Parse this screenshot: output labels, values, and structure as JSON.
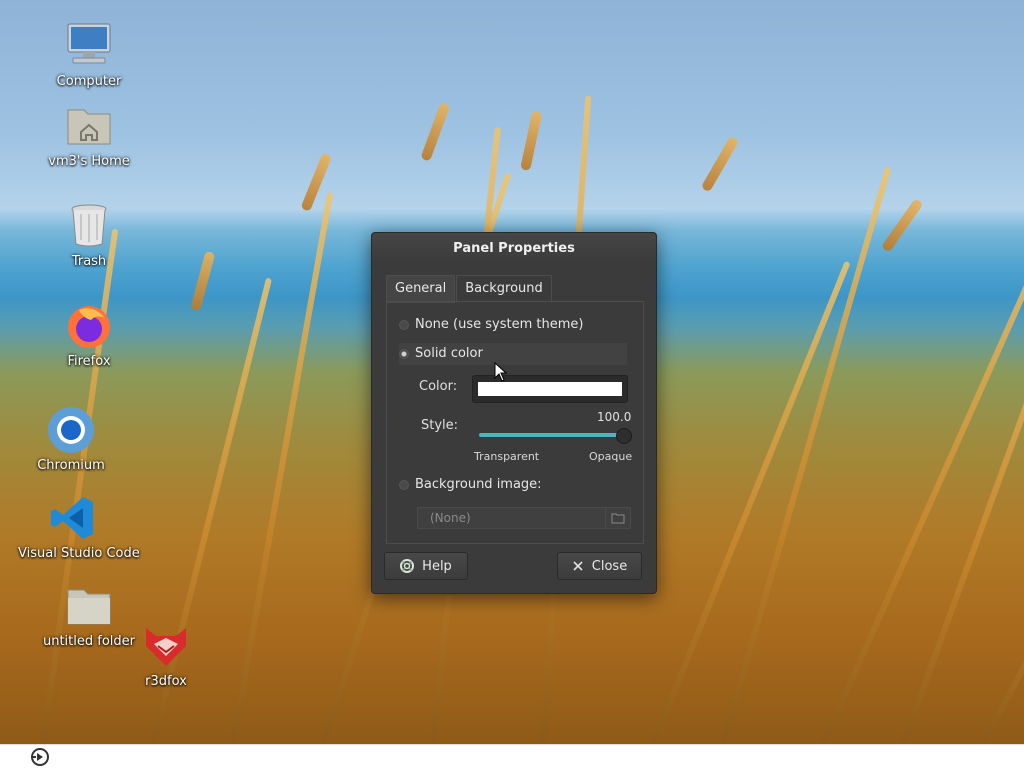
{
  "desktop": {
    "icons": [
      {
        "label": "Computer",
        "icon": "computer-icon"
      },
      {
        "label": "vm3's Home",
        "icon": "home-folder-icon"
      },
      {
        "label": "Trash",
        "icon": "trash-icon"
      },
      {
        "label": "Firefox",
        "icon": "firefox-icon"
      },
      {
        "label": "Chromium",
        "icon": "chromium-icon"
      },
      {
        "label": "Visual Studio Code",
        "icon": "vscode-icon"
      },
      {
        "label": "untitled folder",
        "icon": "folder-icon"
      },
      {
        "label": "r3dfox",
        "icon": "r3dfox-icon"
      }
    ]
  },
  "dialog": {
    "title": "Panel Properties",
    "tabs": [
      {
        "label": "General",
        "active": false
      },
      {
        "label": "Background",
        "active": true
      }
    ],
    "options": {
      "none_label": "None (use system theme)",
      "solid_label": "Solid color",
      "image_label": "Background image:",
      "selected": "solid"
    },
    "color_label": "Color:",
    "color_value": "#ffffff",
    "style_label": "Style:",
    "style_value": "100.0",
    "style_fraction": 1.0,
    "transparent_label": "Transparent",
    "opaque_label": "Opaque",
    "image_placeholder": "(None)",
    "help_label": "Help",
    "close_label": "Close",
    "accent_color": "#4cb4c4"
  },
  "taskbar": {
    "menu_icon": "app-menu-icon"
  }
}
